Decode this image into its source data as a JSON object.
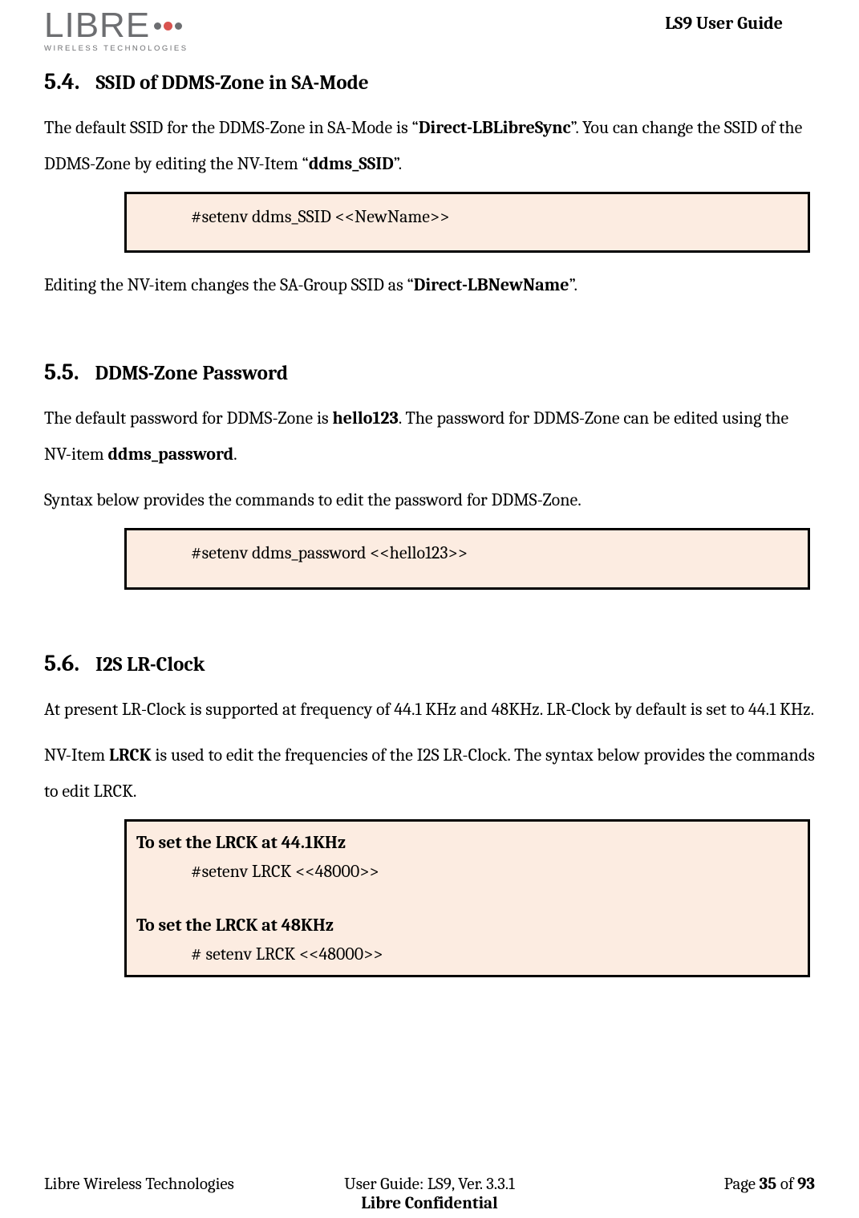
{
  "header": {
    "logo_main": "LIBRE",
    "logo_sub": "WIRELESS TECHNOLOGIES",
    "doc_title": "LS9 User Guide"
  },
  "sections": {
    "s54": {
      "num": "5.4.",
      "title": "SSID of DDMS-Zone in SA-Mode",
      "p1a": "The default SSID for the DDMS-Zone in SA-Mode is “",
      "p1b": "Direct-LBLibreSync",
      "p1c": "”. You can change the SSID of the DDMS-Zone by editing the NV-Item “",
      "p1d": "ddms_SSID",
      "p1e": "”.",
      "cmd": "#setenv ddms_SSID <<NewName>>",
      "p2a": "Editing the NV-item changes the SA-Group SSID as “",
      "p2b": "Direct-LBNewName",
      "p2c": "”."
    },
    "s55": {
      "num": "5.5.",
      "title": "DDMS-Zone Password",
      "p1a": "The default password for DDMS-Zone is ",
      "p1b": "hello123",
      "p1c": ". The password for DDMS-Zone can be edited using the NV-item ",
      "p1d": "ddms_password",
      "p1e": ".",
      "p2": "Syntax below provides the commands to edit the password for DDMS-Zone.",
      "cmd": "#setenv ddms_password <<hello123>>"
    },
    "s56": {
      "num": "5.6.",
      "title": "I2S LR-Clock",
      "p1": "At present LR-Clock is supported at frequency of 44.1 KHz and 48KHz. LR-Clock by default is set to 44.1 KHz.",
      "p2a": "NV-Item ",
      "p2b": "LRCK",
      "p2c": " is used to edit the frequencies of the I2S LR-Clock. The syntax below provides the commands to edit LRCK.",
      "box": {
        "l1": "To set the LRCK at 44.1KHz",
        "c1": "#setenv LRCK <<48000>>",
        "l2": "To set the LRCK at 48KHz",
        "c2": "# setenv LRCK <<48000>>"
      }
    }
  },
  "footer": {
    "left": "Libre Wireless Technologies",
    "center": "User Guide: LS9, Ver. 3.3.1",
    "right_a": "Page ",
    "right_b": "35",
    "right_c": " of ",
    "right_d": "93",
    "conf": "Libre Confidential"
  }
}
